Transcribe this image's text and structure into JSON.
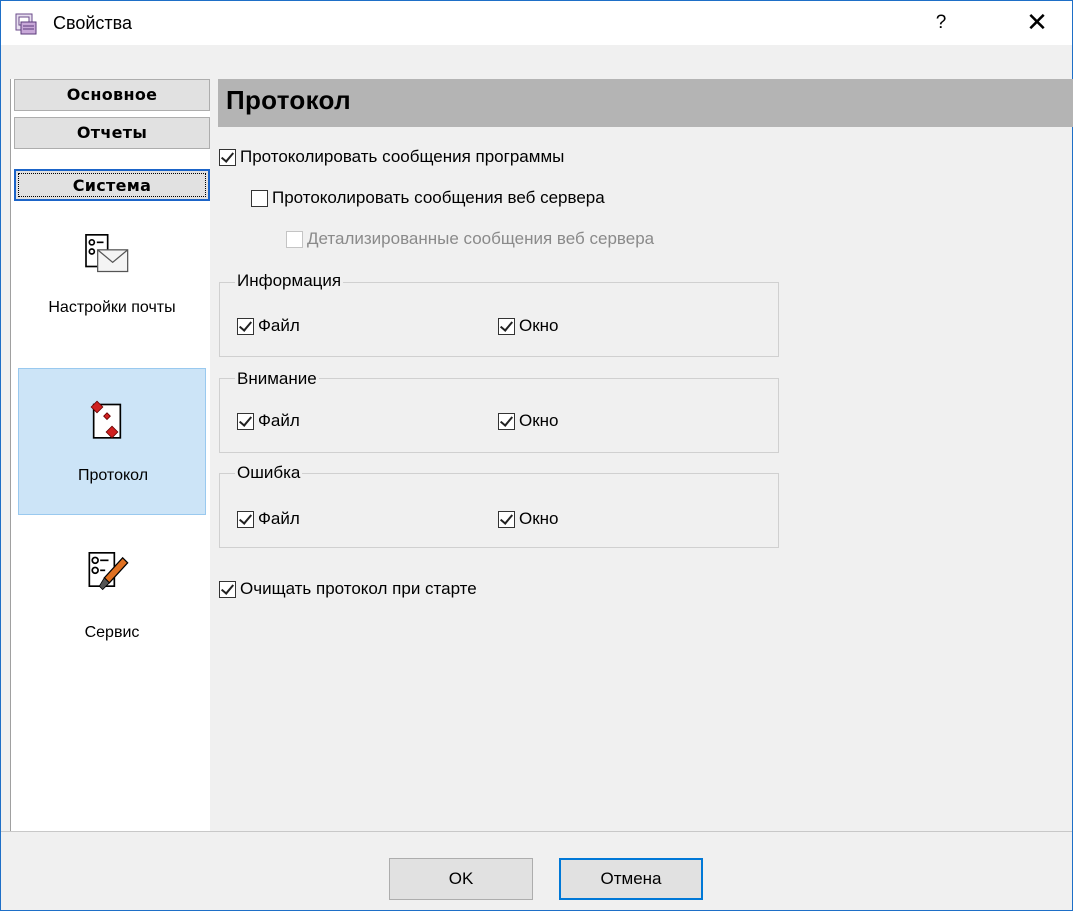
{
  "window": {
    "title": "Свойства",
    "help": "?",
    "close": "✕"
  },
  "categories": [
    {
      "label": "Основное",
      "active": false
    },
    {
      "label": "Отчеты",
      "active": false
    },
    {
      "label": "Система",
      "active": true
    }
  ],
  "nav": {
    "mail": "Настройки почты",
    "log": "Протокол",
    "service": "Сервис"
  },
  "main": {
    "header": "Протокол",
    "log_program": "Протоколировать сообщения программы",
    "log_web": "Протоколировать сообщения веб сервера",
    "log_web_detail": "Детализированные сообщения веб сервера",
    "groups": [
      {
        "title": "Информация",
        "file": "Файл",
        "window": "Окно"
      },
      {
        "title": "Внимание",
        "file": "Файл",
        "window": "Окно"
      },
      {
        "title": "Ошибка",
        "file": "Файл",
        "window": "Окно"
      }
    ],
    "clear_on_start": "Очищать протокол при старте"
  },
  "buttons": {
    "ok": "OK",
    "cancel": "Отмена"
  },
  "colors": {
    "selection": "#cce4f7",
    "header": "#b4b4b4",
    "accent": "#0078d7"
  }
}
